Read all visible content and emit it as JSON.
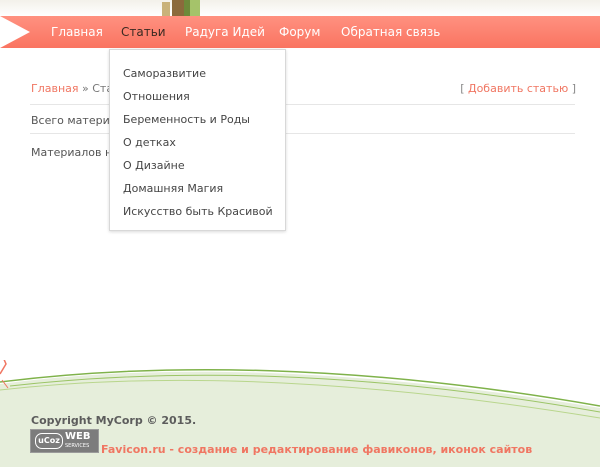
{
  "nav": {
    "items": [
      {
        "label": "Главная"
      },
      {
        "label": "Статьи"
      },
      {
        "label": "Радуга Идей"
      },
      {
        "label": "Форум"
      },
      {
        "label": "Обратная связь"
      }
    ]
  },
  "dropdown": {
    "items": [
      {
        "label": "Саморазвитие"
      },
      {
        "label": "Отношения"
      },
      {
        "label": "Беременность и Роды"
      },
      {
        "label": "О детках"
      },
      {
        "label": "О Дизайне"
      },
      {
        "label": "Домашняя Магия"
      },
      {
        "label": "Искусство быть Красивой"
      }
    ]
  },
  "breadcrumb": {
    "home": "Главная",
    "sep": " » ",
    "current": "Статьи"
  },
  "actions": {
    "add_article": "Добавить статью",
    "bracket_open": "[ ",
    "bracket_close": " ]"
  },
  "content": {
    "total_materials": "Всего материалов",
    "no_materials": "Материалов нет"
  },
  "footer": {
    "copyright": "Copyright MyCorp © 2015.",
    "badge_ucoz": "uCoz",
    "badge_web": "WEB",
    "badge_services": "SERVICES",
    "favicon_link": "Favicon.ru - создание и редактирование фавиконов, иконок сайтов"
  },
  "colors": {
    "nav_bg": "#fa7461",
    "accent": "#f07662",
    "footer_green": "#e4ecd9"
  }
}
